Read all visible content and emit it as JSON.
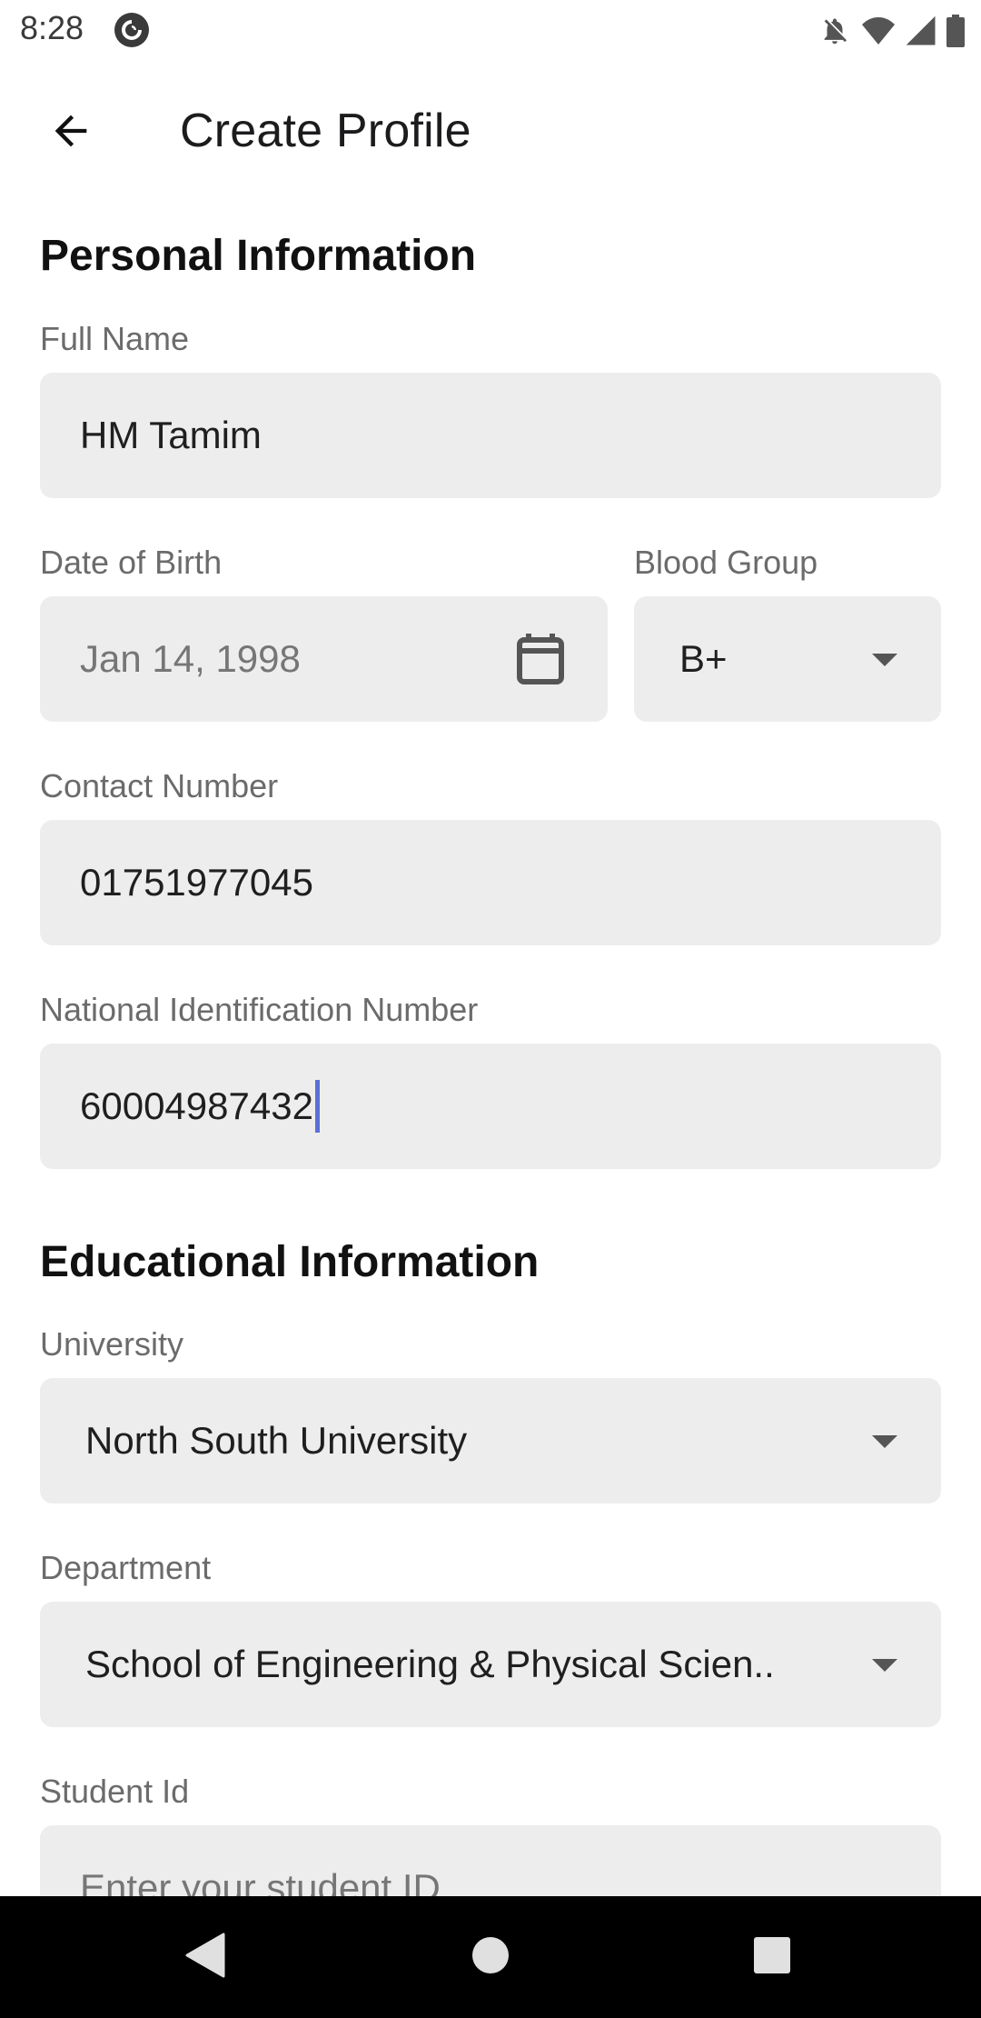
{
  "status_bar": {
    "time": "8:28",
    "app_icon": "pocket-casts-icon",
    "icons": [
      "bell-off-icon",
      "wifi-icon",
      "cellular-signal-icon",
      "battery-icon"
    ]
  },
  "app_bar": {
    "back_icon": "arrow-left-icon",
    "title": "Create Profile"
  },
  "personal": {
    "section_title": "Personal Information",
    "full_name": {
      "label": "Full Name",
      "value": "HM Tamim"
    },
    "dob": {
      "label": "Date of Birth",
      "value": "Jan 14, 1998",
      "icon": "calendar-icon"
    },
    "blood_group": {
      "label": "Blood Group",
      "value": "B+"
    },
    "contact": {
      "label": "Contact Number",
      "value": "01751977045"
    },
    "nid": {
      "label": "National Identification Number",
      "value": "60004987432"
    }
  },
  "education": {
    "section_title": "Educational Information",
    "university": {
      "label": "University",
      "value": "North South University"
    },
    "department": {
      "label": "Department",
      "value": "School of Engineering & Physical Scien.."
    },
    "student_id": {
      "label": "Student Id",
      "placeholder": "Enter your student ID"
    }
  },
  "nav_bar": {
    "buttons": [
      "back-triangle-icon",
      "home-circle-icon",
      "recents-square-icon"
    ]
  },
  "colors": {
    "field_background": "#ededed",
    "caret": "#5b6fd6",
    "nav_background": "#000000"
  }
}
